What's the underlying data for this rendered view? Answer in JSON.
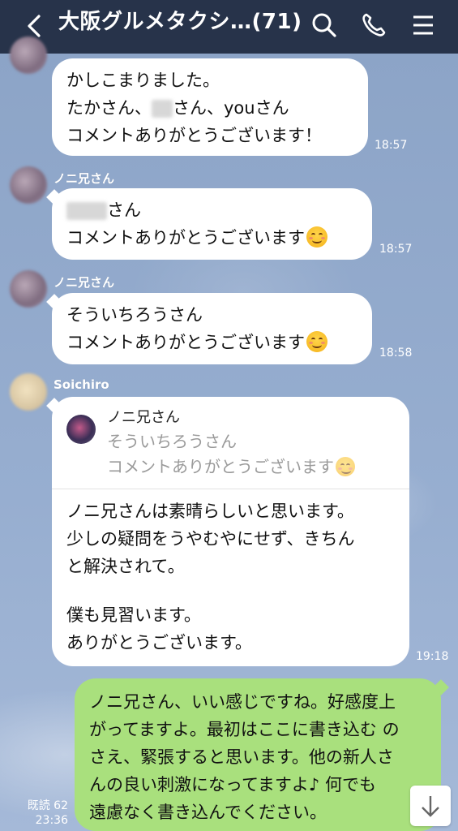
{
  "header": {
    "title": "大阪グルメタクシ…(71)"
  },
  "messages": [
    {
      "lines": [
        "かしこまりました。",
        "たかさん、",
        "さん、youさん",
        "コメントありがとうございます！"
      ],
      "time": "18:57"
    },
    {
      "sender": "ノニ兄さん",
      "lines": [
        "さん",
        "コメントありがとうございます"
      ],
      "time": "18:57"
    },
    {
      "sender": "ノニ兄さん",
      "lines": [
        "そういちろうさん",
        "コメントありがとうございます"
      ],
      "time": "18:58"
    },
    {
      "sender": "Soichiro",
      "quote": {
        "name": "ノニ兄さん",
        "lines": [
          "そういちろうさん",
          "コメントありがとうございます"
        ]
      },
      "lines": [
        "ノニ兄さんは素晴らしいと思います。",
        "少しの疑問をうやむやにせず、きちん",
        "と解決されて。",
        "",
        "僕も見習います。",
        "ありがとうございます。"
      ],
      "time": "19:18"
    }
  ],
  "own_message": {
    "lines": [
      "ノニ兄さん、いい感じですね。好感度上",
      "がってますよ。最初はここに書き込む の",
      "さえ、緊張すると思います。他の新人さ",
      "んの良い刺激になってますよ♪ 何でも",
      "遠慮なく書き込んでください。"
    ],
    "read_label": "既読 62",
    "time": "23:36"
  },
  "icons": {
    "back": "chevron-left-icon",
    "search": "search-icon",
    "call": "phone-icon",
    "menu": "hamburger-menu-icon",
    "scroll": "arrow-down-icon",
    "emoji": "smiling-face-emoji"
  },
  "colors": {
    "header_bg": "#27334a",
    "chat_bg": "#8fa7c9",
    "own_bubble": "#a9e07d",
    "other_bubble": "#ffffff"
  }
}
